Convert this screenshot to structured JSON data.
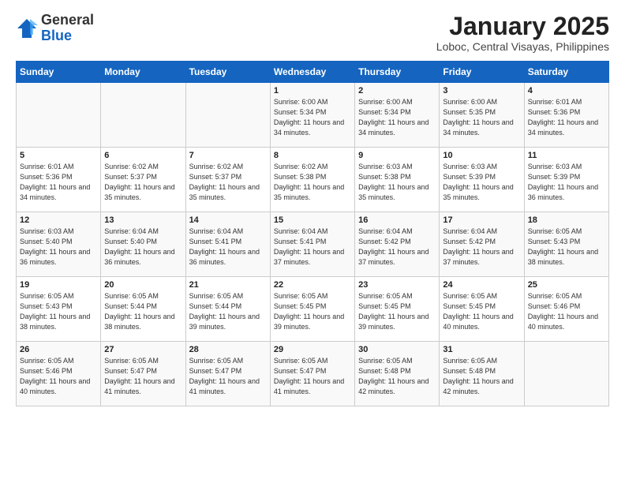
{
  "header": {
    "logo_general": "General",
    "logo_blue": "Blue",
    "month_title": "January 2025",
    "location": "Loboc, Central Visayas, Philippines"
  },
  "days_of_week": [
    "Sunday",
    "Monday",
    "Tuesday",
    "Wednesday",
    "Thursday",
    "Friday",
    "Saturday"
  ],
  "weeks": [
    [
      {
        "day": "",
        "content": ""
      },
      {
        "day": "",
        "content": ""
      },
      {
        "day": "",
        "content": ""
      },
      {
        "day": "1",
        "content": "Sunrise: 6:00 AM\nSunset: 5:34 PM\nDaylight: 11 hours\nand 34 minutes."
      },
      {
        "day": "2",
        "content": "Sunrise: 6:00 AM\nSunset: 5:34 PM\nDaylight: 11 hours\nand 34 minutes."
      },
      {
        "day": "3",
        "content": "Sunrise: 6:00 AM\nSunset: 5:35 PM\nDaylight: 11 hours\nand 34 minutes."
      },
      {
        "day": "4",
        "content": "Sunrise: 6:01 AM\nSunset: 5:36 PM\nDaylight: 11 hours\nand 34 minutes."
      }
    ],
    [
      {
        "day": "5",
        "content": "Sunrise: 6:01 AM\nSunset: 5:36 PM\nDaylight: 11 hours\nand 34 minutes."
      },
      {
        "day": "6",
        "content": "Sunrise: 6:02 AM\nSunset: 5:37 PM\nDaylight: 11 hours\nand 35 minutes."
      },
      {
        "day": "7",
        "content": "Sunrise: 6:02 AM\nSunset: 5:37 PM\nDaylight: 11 hours\nand 35 minutes."
      },
      {
        "day": "8",
        "content": "Sunrise: 6:02 AM\nSunset: 5:38 PM\nDaylight: 11 hours\nand 35 minutes."
      },
      {
        "day": "9",
        "content": "Sunrise: 6:03 AM\nSunset: 5:38 PM\nDaylight: 11 hours\nand 35 minutes."
      },
      {
        "day": "10",
        "content": "Sunrise: 6:03 AM\nSunset: 5:39 PM\nDaylight: 11 hours\nand 35 minutes."
      },
      {
        "day": "11",
        "content": "Sunrise: 6:03 AM\nSunset: 5:39 PM\nDaylight: 11 hours\nand 36 minutes."
      }
    ],
    [
      {
        "day": "12",
        "content": "Sunrise: 6:03 AM\nSunset: 5:40 PM\nDaylight: 11 hours\nand 36 minutes."
      },
      {
        "day": "13",
        "content": "Sunrise: 6:04 AM\nSunset: 5:40 PM\nDaylight: 11 hours\nand 36 minutes."
      },
      {
        "day": "14",
        "content": "Sunrise: 6:04 AM\nSunset: 5:41 PM\nDaylight: 11 hours\nand 36 minutes."
      },
      {
        "day": "15",
        "content": "Sunrise: 6:04 AM\nSunset: 5:41 PM\nDaylight: 11 hours\nand 37 minutes."
      },
      {
        "day": "16",
        "content": "Sunrise: 6:04 AM\nSunset: 5:42 PM\nDaylight: 11 hours\nand 37 minutes."
      },
      {
        "day": "17",
        "content": "Sunrise: 6:04 AM\nSunset: 5:42 PM\nDaylight: 11 hours\nand 37 minutes."
      },
      {
        "day": "18",
        "content": "Sunrise: 6:05 AM\nSunset: 5:43 PM\nDaylight: 11 hours\nand 38 minutes."
      }
    ],
    [
      {
        "day": "19",
        "content": "Sunrise: 6:05 AM\nSunset: 5:43 PM\nDaylight: 11 hours\nand 38 minutes."
      },
      {
        "day": "20",
        "content": "Sunrise: 6:05 AM\nSunset: 5:44 PM\nDaylight: 11 hours\nand 38 minutes."
      },
      {
        "day": "21",
        "content": "Sunrise: 6:05 AM\nSunset: 5:44 PM\nDaylight: 11 hours\nand 39 minutes."
      },
      {
        "day": "22",
        "content": "Sunrise: 6:05 AM\nSunset: 5:45 PM\nDaylight: 11 hours\nand 39 minutes."
      },
      {
        "day": "23",
        "content": "Sunrise: 6:05 AM\nSunset: 5:45 PM\nDaylight: 11 hours\nand 39 minutes."
      },
      {
        "day": "24",
        "content": "Sunrise: 6:05 AM\nSunset: 5:45 PM\nDaylight: 11 hours\nand 40 minutes."
      },
      {
        "day": "25",
        "content": "Sunrise: 6:05 AM\nSunset: 5:46 PM\nDaylight: 11 hours\nand 40 minutes."
      }
    ],
    [
      {
        "day": "26",
        "content": "Sunrise: 6:05 AM\nSunset: 5:46 PM\nDaylight: 11 hours\nand 40 minutes."
      },
      {
        "day": "27",
        "content": "Sunrise: 6:05 AM\nSunset: 5:47 PM\nDaylight: 11 hours\nand 41 minutes."
      },
      {
        "day": "28",
        "content": "Sunrise: 6:05 AM\nSunset: 5:47 PM\nDaylight: 11 hours\nand 41 minutes."
      },
      {
        "day": "29",
        "content": "Sunrise: 6:05 AM\nSunset: 5:47 PM\nDaylight: 11 hours\nand 41 minutes."
      },
      {
        "day": "30",
        "content": "Sunrise: 6:05 AM\nSunset: 5:48 PM\nDaylight: 11 hours\nand 42 minutes."
      },
      {
        "day": "31",
        "content": "Sunrise: 6:05 AM\nSunset: 5:48 PM\nDaylight: 11 hours\nand 42 minutes."
      },
      {
        "day": "",
        "content": ""
      }
    ]
  ]
}
